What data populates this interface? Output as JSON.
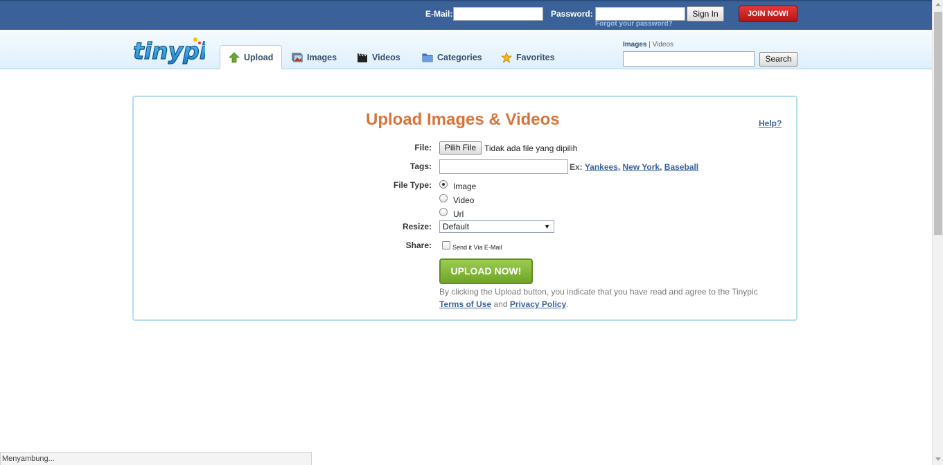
{
  "topbar": {
    "email_label": "E-Mail:",
    "email_value": "",
    "password_label": "Password:",
    "password_value": "",
    "signin_label": "Sign In",
    "forgot_label": "Forgot your password?",
    "join_label": "JOIN NOW!"
  },
  "nav": {
    "logo": "tinypic",
    "tabs": [
      {
        "label": "Upload",
        "icon": "upload-arrow-icon",
        "active": true
      },
      {
        "label": "Images",
        "icon": "images-icon",
        "active": false
      },
      {
        "label": "Videos",
        "icon": "film-clapper-icon",
        "active": false
      },
      {
        "label": "Categories",
        "icon": "folder-icon",
        "active": false
      },
      {
        "label": "Favorites",
        "icon": "star-icon",
        "active": false
      }
    ],
    "search": {
      "scope_selected": "Images",
      "scope_separator": "|",
      "scope_other": "Videos",
      "value": "",
      "button_label": "Search"
    }
  },
  "upload": {
    "title": "Upload Images & Videos",
    "help_label": "Help?",
    "file_label": "File:",
    "file_button": "Pilih File",
    "file_status": "Tidak ada file yang dipilih",
    "tags_label": "Tags:",
    "tags_value": "",
    "tags_example_prefix": "Ex:",
    "tags_examples": [
      "Yankees",
      "New York",
      "Baseball"
    ],
    "filetype_label": "File Type:",
    "filetype_options": [
      "Image",
      "Video",
      "Url"
    ],
    "filetype_selected": "Image",
    "resize_label": "Resize:",
    "resize_value": "Default",
    "share_label": "Share:",
    "share_option": "Send it Via E-Mail",
    "share_checked": false,
    "upload_button": "UPLOAD NOW!",
    "legal_text": "By clicking the Upload button, you indicate that you have read and agree to the Tinypic",
    "terms_label": "Terms of Use",
    "and_text": "and",
    "privacy_label": "Privacy Policy",
    "period": "."
  },
  "status": {
    "text": "Menyambung..."
  },
  "colors": {
    "topbar": "#3a6299",
    "title": "#d9733a",
    "join": "#c41e1e",
    "upload_button": "#7fb83a",
    "panel_border": "#b5dcee"
  }
}
